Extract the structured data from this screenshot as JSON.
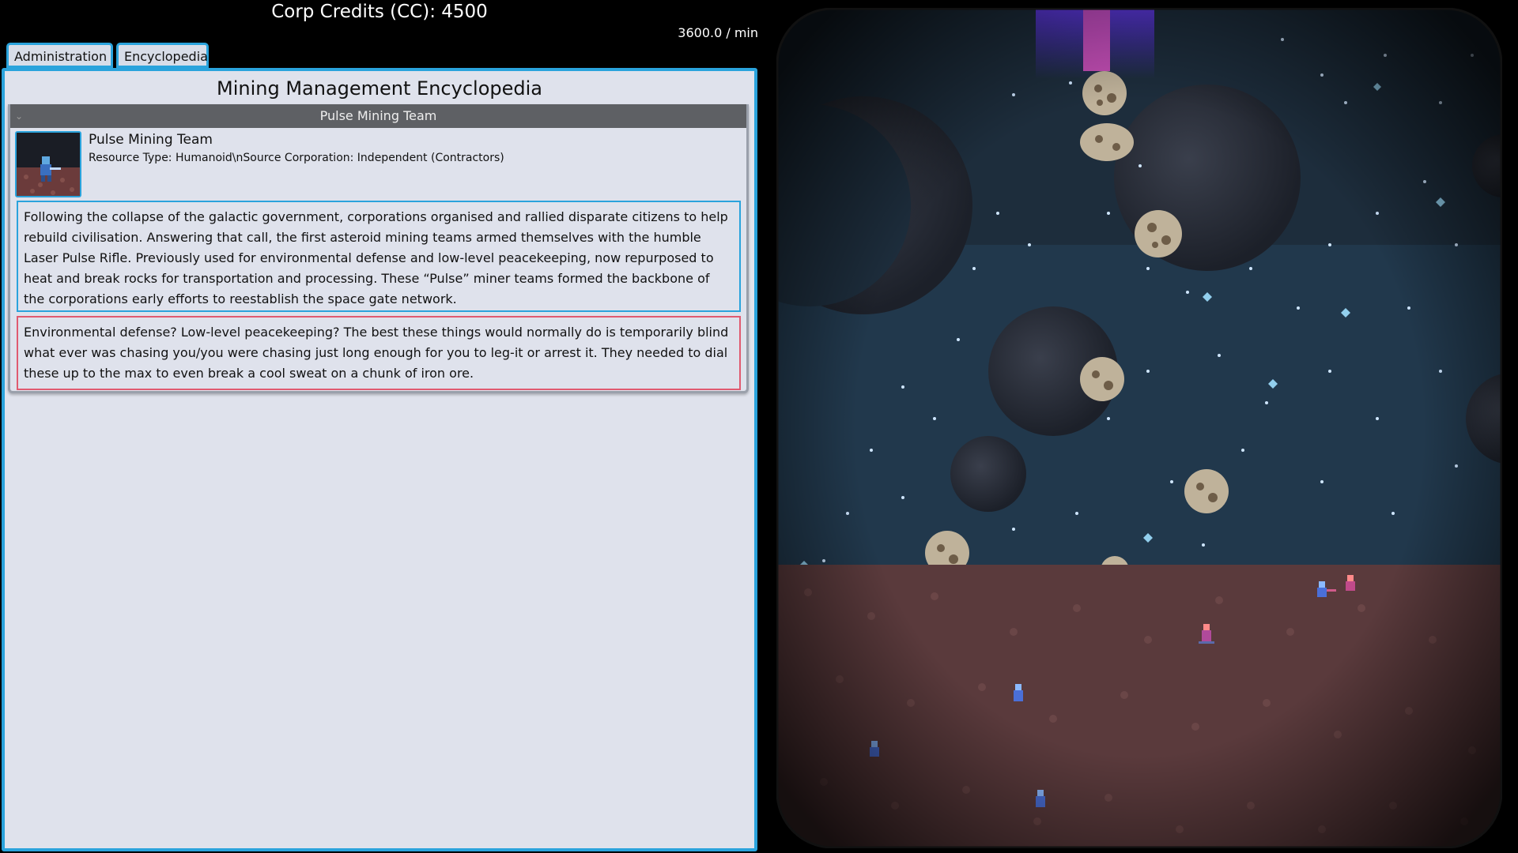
{
  "header": {
    "credits": "Corp Credits (CC): 4500",
    "rate": "3600.0 / min"
  },
  "tabs": [
    {
      "label": "Administration"
    },
    {
      "label": "Encyclopedia"
    }
  ],
  "panel": {
    "title": "Mining Management Encyclopedia",
    "entry": {
      "header": "Pulse Mining Team",
      "name": "Pulse Mining Team",
      "meta": "Resource Type: Humanoid\\nSource Corporation: Independent (Contractors)",
      "lore": "Following the collapse of the galactic government, corporations organised and rallied disparate citizens to help rebuild civilisation.  Answering that call, the first asteroid mining teams armed themselves with the humble Laser Pulse Rifle. Previously used for environmental defense and low-level peacekeeping, now repurposed to heat and break rocks for transportation and processing. These “Pulse” miner teams formed the backbone of the corporations early efforts to reestablish the space gate network.",
      "quip": "Environmental defense? Low-level peacekeeping? The best these things would normally do is temporarily blind what ever was chasing you/you were chasing just long enough for you to leg-it or arrest it. They needed to dial these up to the max to even break a cool sweat on a chunk of iron ore."
    }
  },
  "colors": {
    "accent": "#2aa3dc",
    "quip_border": "#e05a70",
    "panel_bg": "#dfe2ec",
    "entry_header": "#5e6064"
  },
  "icons": {
    "entry_chevron": "chevron-down-icon"
  }
}
